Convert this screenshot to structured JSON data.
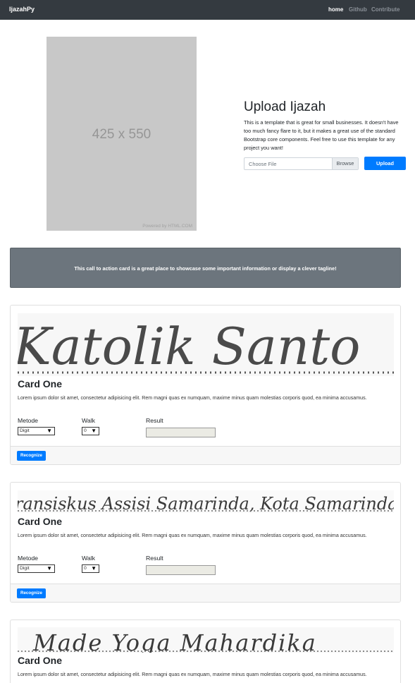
{
  "navbar": {
    "brand": "IjazahPy",
    "links": [
      {
        "label": "home",
        "active": true
      },
      {
        "label": "Github",
        "active": false
      },
      {
        "label": "Contribute",
        "active": false
      }
    ]
  },
  "hero": {
    "placeholder_size": "425 x 550",
    "placeholder_credit": "Powered by HTML.COM",
    "title": "Upload Ijazah",
    "description": "This is a template that is great for small businesses. It doesn't have too much fancy flare to it, but it makes a great use of the standard Bootstrap core components. Feel free to use this template for any project you want!",
    "file_placeholder": "Choose File",
    "browse_label": "Browse",
    "upload_label": "Upload"
  },
  "cta": {
    "text": "This call to action card is a great place to showcase some important information or display a clever tagline!"
  },
  "cards": [
    {
      "handwriting": "Katolik Santo",
      "title": "Card One",
      "description": "Lorem ipsum dolor sit amet, consectetur adipisicing elit. Rem magni quas ex numquam, maxime minus quam molestias corporis quod, ea minima accusamus.",
      "metode_label": "Metode",
      "metode_value": "Digit",
      "walk_label": "Walk",
      "walk_value": "0",
      "result_label": "Result",
      "result_value": "",
      "button_label": "Recognize"
    },
    {
      "handwriting": "ransiskus Assisi Samarinda, Kota Samarinda",
      "title": "Card One",
      "description": "Lorem ipsum dolor sit amet, consectetur adipisicing elit. Rem magni quas ex numquam, maxime minus quam molestias corporis quod, ea minima accusamus.",
      "metode_label": "Metode",
      "metode_value": "Digit",
      "walk_label": "Walk",
      "walk_value": "0",
      "result_label": "Result",
      "result_value": "",
      "button_label": "Recognize"
    },
    {
      "handwriting": "Made Yoga Mahardika",
      "title": "Card One",
      "description": "Lorem ipsum dolor sit amet, consectetur adipisicing elit. Rem magni quas ex numquam, maxime minus quam molestias corporis quod, ea minima accusamus."
    }
  ],
  "colors": {
    "navbar": "#343a40",
    "primary": "#007bff",
    "cta_bg": "#6c757d",
    "placeholder_bg": "#c8c8c8"
  }
}
